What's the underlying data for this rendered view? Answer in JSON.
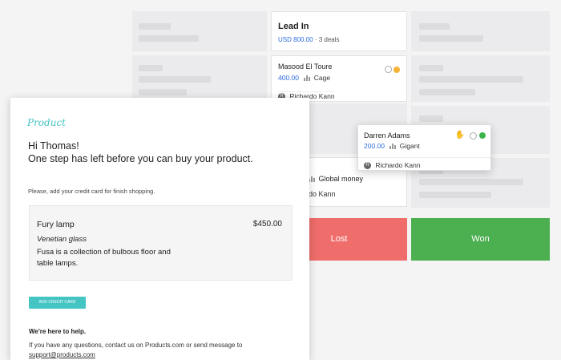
{
  "board": {
    "column_title": "Lead In",
    "column_amount": "USD 800.00",
    "column_deals": "3 deals",
    "deal1": {
      "name": "Masood El Toure",
      "value": "400.00",
      "org": "Cage",
      "owner": "Richardo Kann"
    },
    "deal2": {
      "org": "Global money",
      "owner_partial": "do Kann"
    },
    "drag_card": {
      "name": "Darren Adams",
      "value": "200.00",
      "org": "Gigant",
      "owner": "Richardo Kann"
    },
    "lost_label": "Lost",
    "won_label": "Won",
    "colors": {
      "lost": "#ef6d6b",
      "won": "#4caf50",
      "accent": "#2d6cdf",
      "status_orange": "#f5b335",
      "status_green": "#3cb44b"
    }
  },
  "email": {
    "brand": "Product",
    "greeting_line1": "Hi Thomas!",
    "greeting_line2": "One step has left before you can buy your product.",
    "instruction": "Please, add your credit card for finish shopping.",
    "product": {
      "name": "Fury lamp",
      "price": "$450.00",
      "subtitle": "Venetian glass",
      "description": "Fusa is a collection of bulbous floor and table lamps."
    },
    "cta_label": "ADD CREDIT CARD",
    "help_title": "We're here to help.",
    "help_text": "If you have any questions, contact us on Products.com or send message to",
    "help_email": "support@products.com",
    "colors": {
      "brand": "#45c4c4"
    }
  }
}
